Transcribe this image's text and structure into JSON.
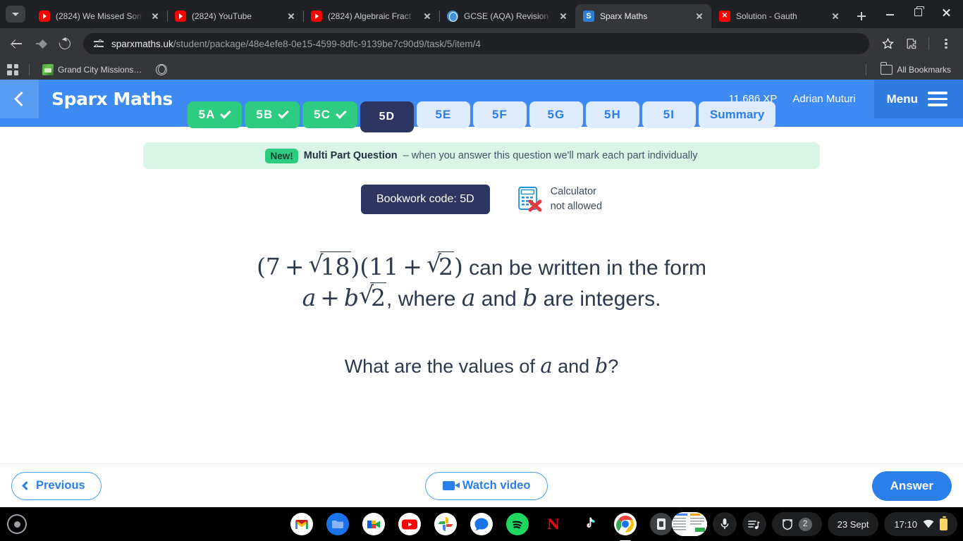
{
  "browser": {
    "tabs": [
      {
        "title": "(2824) We Missed Som",
        "favicon": "youtube-icon",
        "active": false
      },
      {
        "title": "(2824) YouTube",
        "favicon": "youtube-icon",
        "active": false
      },
      {
        "title": "(2824) Algebraic Fract",
        "favicon": "youtube-icon",
        "active": false
      },
      {
        "title": "GCSE (AQA) Revision |",
        "favicon": "globe-icon",
        "active": false
      },
      {
        "title": "Sparx Maths",
        "favicon": "sparx-icon",
        "active": true
      },
      {
        "title": "Solution - Gauth",
        "favicon": "gauth-icon",
        "active": false
      }
    ],
    "new_tab_label": "+",
    "url": "sparxmaths.uk/student/package/48e4efe8-0e15-4599-8dfc-9139be7c90d9/task/5/item/4",
    "url_domain": "sparxmaths.uk",
    "url_path": "/student/package/48e4efe8-0e15-4599-8dfc-9139be7c90d9/task/5/item/4",
    "bookmarks": [
      {
        "label": "Grand City Missions…",
        "favicon": "game-icon"
      },
      {
        "label": "",
        "favicon": "globe-outline-icon"
      }
    ],
    "all_bookmarks_label": "All Bookmarks"
  },
  "sparx": {
    "brand": "Sparx Maths",
    "xp": "11,686 XP",
    "user": "Adrian Muturi",
    "menu_label": "Menu",
    "question_tabs": [
      {
        "label": "5A",
        "state": "done"
      },
      {
        "label": "5B",
        "state": "done"
      },
      {
        "label": "5C",
        "state": "done"
      },
      {
        "label": "5D",
        "state": "active"
      },
      {
        "label": "5E",
        "state": "todo"
      },
      {
        "label": "5F",
        "state": "todo"
      },
      {
        "label": "5G",
        "state": "todo"
      },
      {
        "label": "5H",
        "state": "todo"
      },
      {
        "label": "5I",
        "state": "todo"
      },
      {
        "label": "Summary",
        "state": "todo"
      }
    ],
    "banner": {
      "pill": "New!",
      "bold": "Multi Part Question",
      "rest": "– when you answer this question we'll mark each part individually"
    },
    "bookwork_code": "Bookwork code: 5D",
    "calculator_line1": "Calculator",
    "calculator_line2": "not allowed",
    "question": {
      "line1_parts": {
        "open1": "(",
        "seven": "7",
        "plus1": "+",
        "root18": "18",
        "close1": ")",
        "open2": "(",
        "eleven": "11",
        "plus2": "+",
        "root2a": "2",
        "close2": ")",
        "text": " can be written in the form"
      },
      "line2_parts": {
        "a": "a",
        "plus": "+",
        "b": "b",
        "root2b": "2",
        "text": ", where ",
        "a2": "a",
        "and": " and ",
        "b2": "b",
        "tail": " are integers."
      },
      "line3_parts": {
        "pre": "What are the values of ",
        "a": "a",
        "and": " and ",
        "b": "b",
        "post": "?"
      }
    },
    "buttons": {
      "previous": "Previous",
      "watch_video": "Watch video",
      "answer": "Answer"
    }
  },
  "shelf": {
    "apps": [
      {
        "name": "gmail-icon",
        "glyph": "M"
      },
      {
        "name": "files-icon",
        "glyph": ""
      },
      {
        "name": "google-meet-icon",
        "glyph": ""
      },
      {
        "name": "youtube-icon",
        "glyph": ""
      },
      {
        "name": "google-photos-icon",
        "glyph": ""
      },
      {
        "name": "messages-icon",
        "glyph": ""
      },
      {
        "name": "spotify-icon",
        "glyph": ""
      },
      {
        "name": "netflix-icon",
        "glyph": "N"
      },
      {
        "name": "tiktok-icon",
        "glyph": "♪"
      },
      {
        "name": "chrome-icon",
        "glyph": ""
      },
      {
        "name": "app-icon",
        "glyph": ""
      }
    ],
    "notification_count": "2",
    "date": "23 Sept",
    "time": "17:10"
  },
  "colors": {
    "sparx_blue": "#3d8bf2",
    "sparx_navy": "#2d3561",
    "green": "#2ecc80",
    "accent_blue": "#2a7fe8"
  }
}
